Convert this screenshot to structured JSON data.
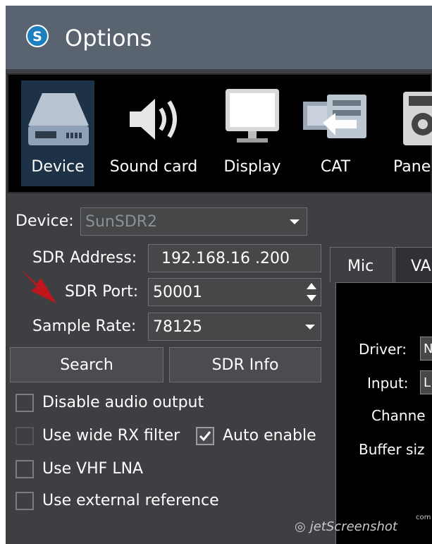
{
  "window": {
    "title": "Options",
    "icon": "app-logo-icon"
  },
  "toolbar": {
    "items": [
      {
        "label": "Device",
        "icon": "device-icon",
        "active": true
      },
      {
        "label": "Sound card",
        "icon": "speaker-icon",
        "active": false
      },
      {
        "label": "Display",
        "icon": "monitor-icon",
        "active": false
      },
      {
        "label": "CAT",
        "icon": "cat-icon",
        "active": false
      },
      {
        "label": "Pane",
        "icon": "panel-icon",
        "active": false
      }
    ]
  },
  "device": {
    "label": "Device:",
    "value": "SunSDR2"
  },
  "sdr_address": {
    "label": "SDR Address:",
    "value": "192.168.16 .200"
  },
  "sdr_port": {
    "label": "SDR Port:",
    "value": "50001"
  },
  "sample_rate": {
    "label": "Sample Rate:",
    "value": "78125"
  },
  "buttons": {
    "search": "Search",
    "sdr_info": "SDR Info"
  },
  "checkboxes": {
    "disable_audio": {
      "label": "Disable audio output",
      "checked": false
    },
    "wide_rx": {
      "label": "Use wide RX filter",
      "checked": false
    },
    "auto_enable": {
      "label": "Auto enable",
      "checked": true
    },
    "vhf_lna": {
      "label": "Use VHF LNA",
      "checked": false
    },
    "external_ref": {
      "label": "Use external reference",
      "checked": false
    }
  },
  "tabs": [
    {
      "label": "Mic",
      "active": true
    },
    {
      "label": "VA",
      "active": false
    }
  ],
  "mic_panel": {
    "driver": "Driver:",
    "driver_value": "N",
    "input": "Input:",
    "input_value": "L",
    "channel": "Channe",
    "buffer": "Buffer siz"
  },
  "watermark": {
    "text": "jetScreenshot",
    "sup": "com"
  },
  "colors": {
    "titlebar": "#5a6471",
    "window": "#3d3f42",
    "toolbar": "#000000",
    "active_tool": "#1e3247",
    "arrow": "#c0151b"
  }
}
